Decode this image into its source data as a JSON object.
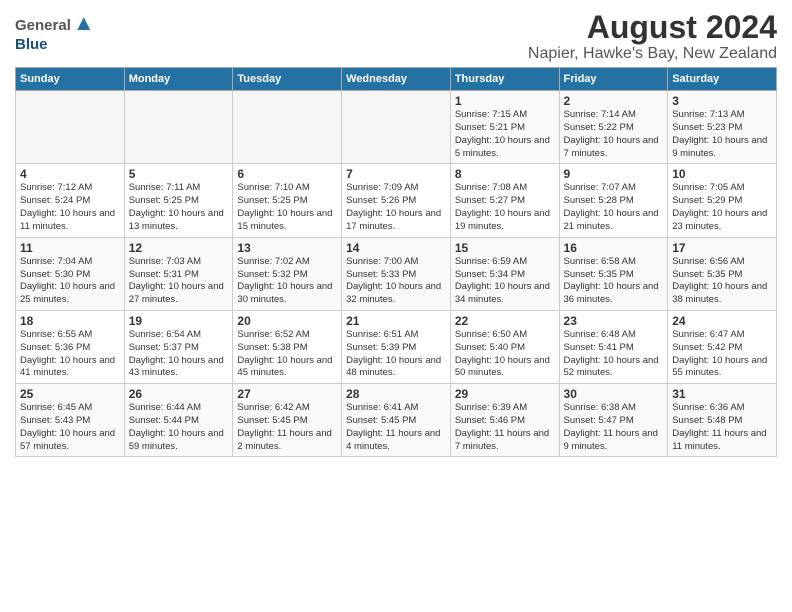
{
  "header": {
    "logo_general": "General",
    "logo_blue": "Blue",
    "title": "August 2024",
    "subtitle": "Napier, Hawke's Bay, New Zealand"
  },
  "calendar": {
    "days_of_week": [
      "Sunday",
      "Monday",
      "Tuesday",
      "Wednesday",
      "Thursday",
      "Friday",
      "Saturday"
    ],
    "weeks": [
      [
        {
          "day": "",
          "info": ""
        },
        {
          "day": "",
          "info": ""
        },
        {
          "day": "",
          "info": ""
        },
        {
          "day": "",
          "info": ""
        },
        {
          "day": "1",
          "info": "Sunrise: 7:15 AM\nSunset: 5:21 PM\nDaylight: 10 hours\nand 5 minutes."
        },
        {
          "day": "2",
          "info": "Sunrise: 7:14 AM\nSunset: 5:22 PM\nDaylight: 10 hours\nand 7 minutes."
        },
        {
          "day": "3",
          "info": "Sunrise: 7:13 AM\nSunset: 5:23 PM\nDaylight: 10 hours\nand 9 minutes."
        }
      ],
      [
        {
          "day": "4",
          "info": "Sunrise: 7:12 AM\nSunset: 5:24 PM\nDaylight: 10 hours\nand 11 minutes."
        },
        {
          "day": "5",
          "info": "Sunrise: 7:11 AM\nSunset: 5:25 PM\nDaylight: 10 hours\nand 13 minutes."
        },
        {
          "day": "6",
          "info": "Sunrise: 7:10 AM\nSunset: 5:25 PM\nDaylight: 10 hours\nand 15 minutes."
        },
        {
          "day": "7",
          "info": "Sunrise: 7:09 AM\nSunset: 5:26 PM\nDaylight: 10 hours\nand 17 minutes."
        },
        {
          "day": "8",
          "info": "Sunrise: 7:08 AM\nSunset: 5:27 PM\nDaylight: 10 hours\nand 19 minutes."
        },
        {
          "day": "9",
          "info": "Sunrise: 7:07 AM\nSunset: 5:28 PM\nDaylight: 10 hours\nand 21 minutes."
        },
        {
          "day": "10",
          "info": "Sunrise: 7:05 AM\nSunset: 5:29 PM\nDaylight: 10 hours\nand 23 minutes."
        }
      ],
      [
        {
          "day": "11",
          "info": "Sunrise: 7:04 AM\nSunset: 5:30 PM\nDaylight: 10 hours\nand 25 minutes."
        },
        {
          "day": "12",
          "info": "Sunrise: 7:03 AM\nSunset: 5:31 PM\nDaylight: 10 hours\nand 27 minutes."
        },
        {
          "day": "13",
          "info": "Sunrise: 7:02 AM\nSunset: 5:32 PM\nDaylight: 10 hours\nand 30 minutes."
        },
        {
          "day": "14",
          "info": "Sunrise: 7:00 AM\nSunset: 5:33 PM\nDaylight: 10 hours\nand 32 minutes."
        },
        {
          "day": "15",
          "info": "Sunrise: 6:59 AM\nSunset: 5:34 PM\nDaylight: 10 hours\nand 34 minutes."
        },
        {
          "day": "16",
          "info": "Sunrise: 6:58 AM\nSunset: 5:35 PM\nDaylight: 10 hours\nand 36 minutes."
        },
        {
          "day": "17",
          "info": "Sunrise: 6:56 AM\nSunset: 5:35 PM\nDaylight: 10 hours\nand 38 minutes."
        }
      ],
      [
        {
          "day": "18",
          "info": "Sunrise: 6:55 AM\nSunset: 5:36 PM\nDaylight: 10 hours\nand 41 minutes."
        },
        {
          "day": "19",
          "info": "Sunrise: 6:54 AM\nSunset: 5:37 PM\nDaylight: 10 hours\nand 43 minutes."
        },
        {
          "day": "20",
          "info": "Sunrise: 6:52 AM\nSunset: 5:38 PM\nDaylight: 10 hours\nand 45 minutes."
        },
        {
          "day": "21",
          "info": "Sunrise: 6:51 AM\nSunset: 5:39 PM\nDaylight: 10 hours\nand 48 minutes."
        },
        {
          "day": "22",
          "info": "Sunrise: 6:50 AM\nSunset: 5:40 PM\nDaylight: 10 hours\nand 50 minutes."
        },
        {
          "day": "23",
          "info": "Sunrise: 6:48 AM\nSunset: 5:41 PM\nDaylight: 10 hours\nand 52 minutes."
        },
        {
          "day": "24",
          "info": "Sunrise: 6:47 AM\nSunset: 5:42 PM\nDaylight: 10 hours\nand 55 minutes."
        }
      ],
      [
        {
          "day": "25",
          "info": "Sunrise: 6:45 AM\nSunset: 5:43 PM\nDaylight: 10 hours\nand 57 minutes."
        },
        {
          "day": "26",
          "info": "Sunrise: 6:44 AM\nSunset: 5:44 PM\nDaylight: 10 hours\nand 59 minutes."
        },
        {
          "day": "27",
          "info": "Sunrise: 6:42 AM\nSunset: 5:45 PM\nDaylight: 11 hours\nand 2 minutes."
        },
        {
          "day": "28",
          "info": "Sunrise: 6:41 AM\nSunset: 5:45 PM\nDaylight: 11 hours\nand 4 minutes."
        },
        {
          "day": "29",
          "info": "Sunrise: 6:39 AM\nSunset: 5:46 PM\nDaylight: 11 hours\nand 7 minutes."
        },
        {
          "day": "30",
          "info": "Sunrise: 6:38 AM\nSunset: 5:47 PM\nDaylight: 11 hours\nand 9 minutes."
        },
        {
          "day": "31",
          "info": "Sunrise: 6:36 AM\nSunset: 5:48 PM\nDaylight: 11 hours\nand 11 minutes."
        }
      ]
    ]
  }
}
